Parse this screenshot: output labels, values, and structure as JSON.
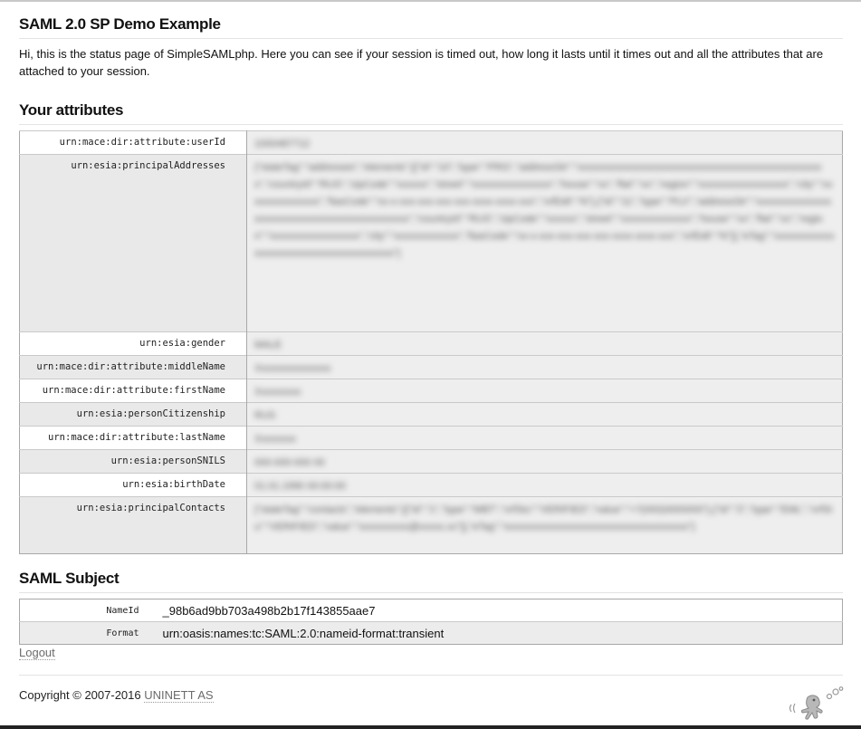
{
  "page": {
    "title": "SAML 2.0 SP Demo Example",
    "intro": "Hi, this is the status page of SimpleSAMLphp. Here you can see if your session is timed out, how long it lasts until it times out and all the attributes that are attached to your session."
  },
  "attributes": {
    "heading": "Your attributes",
    "rows": [
      {
        "key": "urn:mace:dir:attribute:userId",
        "value": "1000487712"
      },
      {
        "key": "urn:esia:principalAddresses",
        "value": "{\"stateTag\":\"addresses\",\"elements\":[{\"id\":\"10\",\"type\":\"PRG\",\"addressStr\":\"xxxxxxxxxxxxxxxxxxxxxxxxxxxxxxxxxxxxxxxxxxxxxxxxxx\",\"countryId\":\"RUS\",\"zipCode\":\"xxxxxx\",\"street\":\"xxxxxxxxxxxxxxxx\",\"house\":\"xx\",\"flat\":\"xx\",\"region\":\"xxxxxxxxxxxxxxxxxx\",\"city\":\"xxxxxxxxxxxxxxx\",\"fiasCode\":\"xx-x-xxx-xxx-xxx-xxx-xxxx-xxxx-xxx\",\"vrfDdt\":\"N\"},{\"id\":\"11\",\"type\":\"PLV\",\"addressStr\":\"xxxxxxxxxxxxxxxxxxxxxxxxxxxxxxxxxxxxxxxxxxxxxx\",\"countryId\":\"RUS\",\"zipCode\":\"xxxxxx\",\"street\":\"xxxxxxxxxxxxxx\",\"house\":\"xx\",\"flat\":\"xx\",\"region\":\"xxxxxxxxxxxxxxxxxx\",\"city\":\"xxxxxxxxxxxxx\",\"fiasCode\":\"xx-x-xxx-xxx-xxx-xxx-xxxx-xxxx-xxx\",\"vrfDdt\":\"N\"}],\"eTag\":\"xxxxxxxxxxxxxxxxxxxxxxxxxxxxxxxxxxxxxxxx\"}"
      },
      {
        "key": "urn:esia:gender",
        "value": "MALE"
      },
      {
        "key": "urn:mace:dir:attribute:middleName",
        "value": "Xxxxxxxxxxxxxxx"
      },
      {
        "key": "urn:mace:dir:attribute:firstName",
        "value": "Xxxxxxxxx"
      },
      {
        "key": "urn:esia:personCitizenship",
        "value": "RUS"
      },
      {
        "key": "urn:mace:dir:attribute:lastName",
        "value": "Xxxxxxxx"
      },
      {
        "key": "urn:esia:personSNILS",
        "value": "000-000-000 00"
      },
      {
        "key": "urn:esia:birthDate",
        "value": "01.01.1990 00:00:00"
      },
      {
        "key": "urn:esia:principalContacts",
        "value": "{\"stateTag\":\"contacts\",\"elements\":[{\"id\":\"1\",\"type\":\"MBT\",\"vrfStu\":\"VERIFIED\",\"value\":\"+7(000)0000000\"},{\"id\":\"2\",\"type\":\"EML\",\"vrfStu\":\"VERIFIED\",\"value\":\"xxxxxxxxxx@xxxxx.xx\"}],\"eTag\":\"xxxxxxxxxxxxxxxxxxxxxxxxxxxxxxxxxxxxx\"}"
      }
    ]
  },
  "subject": {
    "heading": "SAML Subject",
    "rows": [
      {
        "key": "NameId",
        "value": "_98b6ad9bb703a498b2b17f143855aae7"
      },
      {
        "key": "Format",
        "value": "urn:oasis:names:tc:SAML:2.0:nameid-format:transient"
      }
    ]
  },
  "links": {
    "logout": "Logout"
  },
  "footer": {
    "copyright_prefix": "Copyright © 2007-2016 ",
    "company": "UNINETT AS",
    "logo_icon": "simplesamlphp-logo-icon"
  }
}
